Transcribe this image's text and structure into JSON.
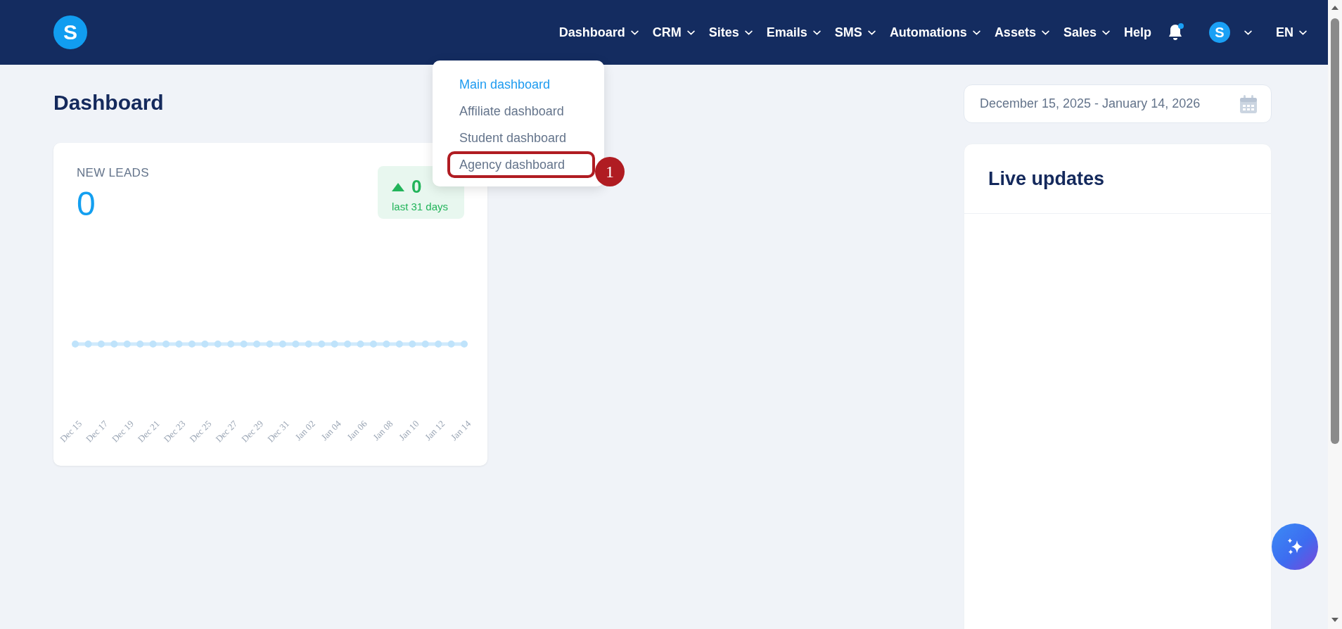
{
  "nav": {
    "items": [
      {
        "label": "Dashboard",
        "caret": true
      },
      {
        "label": "CRM",
        "caret": true
      },
      {
        "label": "Sites",
        "caret": true
      },
      {
        "label": "Emails",
        "caret": true
      },
      {
        "label": "SMS",
        "caret": true
      },
      {
        "label": "Automations",
        "caret": true
      },
      {
        "label": "Assets",
        "caret": true
      },
      {
        "label": "Sales",
        "caret": true
      },
      {
        "label": "Help",
        "caret": false
      }
    ],
    "notification_dot": true,
    "avatar": "S",
    "language": "EN",
    "logo": "S"
  },
  "dropdown": {
    "items": [
      {
        "label": "Main dashboard",
        "selected": true,
        "highlighted": false
      },
      {
        "label": "Affiliate dashboard",
        "selected": false,
        "highlighted": false
      },
      {
        "label": "Student dashboard",
        "selected": false,
        "highlighted": false
      },
      {
        "label": "Agency dashboard",
        "selected": false,
        "highlighted": true
      }
    ],
    "step_badge": "1"
  },
  "page_title": "Dashboard",
  "date_range": {
    "value": "December 15, 2025 - January 14, 2026"
  },
  "leads_card": {
    "title": "NEW LEADS",
    "value": "0",
    "change": "0",
    "change_period": "last 31 days",
    "axis_labels": [
      "Dec 15",
      "Dec 17",
      "Dec 19",
      "Dec 21",
      "Dec 23",
      "Dec 25",
      "Dec 27",
      "Dec 29",
      "Dec 31",
      "Jan 02",
      "Jan 04",
      "Jan 06",
      "Jan 08",
      "Jan 10",
      "Jan 12",
      "Jan 14"
    ]
  },
  "live_updates": {
    "title": "Live updates"
  }
}
